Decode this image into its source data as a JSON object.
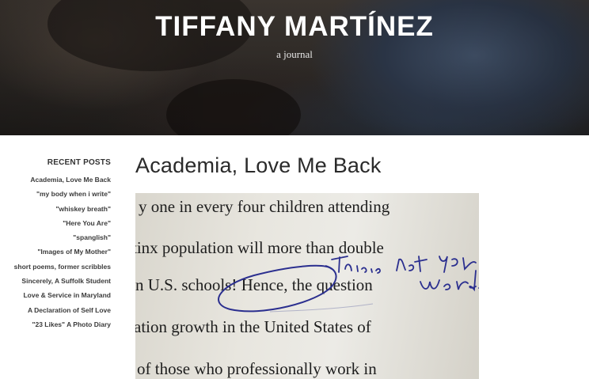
{
  "site": {
    "title": "TIFFANY MARTÍNEZ",
    "tagline": "a journal"
  },
  "sidebar": {
    "heading": "RECENT POSTS",
    "items": [
      "Academia, Love Me Back",
      "\"my body when i write\"",
      "\"whiskey breath\"",
      "\"Here You Are\"",
      "\"spanglish\"",
      "\"Images of My Mother\"",
      "short poems, former scribbles",
      "Sincerely, A Suffolk Student",
      "Love & Service in Maryland",
      "A Declaration of Self Love",
      "\"23 Likes\" A Photo Diary"
    ]
  },
  "post": {
    "title": "Academia, Love Me Back",
    "image": {
      "printed_lines": [
        "y one in every four children attending",
        "tinx population will more than double",
        "n U.S. schools! Hence, the question",
        "ation growth in the United States of",
        "of those who professionally work in"
      ],
      "handwritten_note": "This is not your word."
    }
  },
  "colors": {
    "ink": "#2b2f8f",
    "title_text": "#ffffff",
    "post_title": "#2a2a2a"
  }
}
